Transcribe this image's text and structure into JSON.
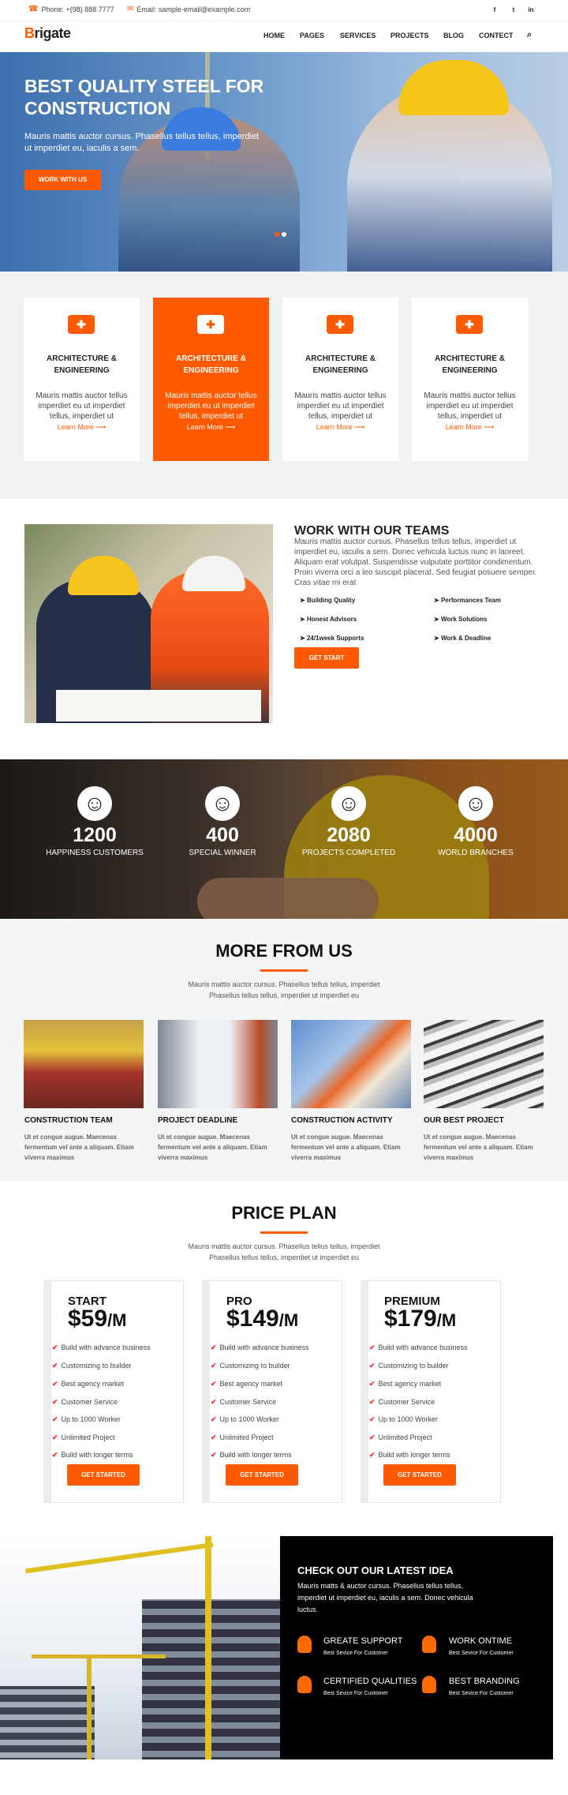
{
  "topbar": {
    "phone": "Phone: +(98) 888 7777",
    "email": "Email: sample-email@example.com",
    "social": [
      "f",
      "t",
      "in"
    ]
  },
  "nav": {
    "logo_b": "B",
    "logo_rest": "rigate",
    "items": [
      "HOME",
      "PAGES",
      "SERVICES",
      "PROJECTS",
      "BLOG",
      "CONTECT"
    ]
  },
  "hero": {
    "title": "BEST QUALITY STEEL FOR CONSTRUCTION",
    "text": "Mauris mattis auctor cursus. Phasellus tellus tellus, imperdiet ut imperdiet eu, iaculis a sem.",
    "button": "WORK WITH US"
  },
  "features": [
    {
      "title": "ARCHITECTURE & ENGINEERING",
      "text": "Mauris mattis auctor tellus imperdiet eu ut imperdiet tellus, imperdiet ut",
      "link": "Learn More"
    },
    {
      "title": "ARCHITECTURE & ENGINEERING",
      "text": "Mauris mattis auctor tellus imperdiet eu ut imperdiet tellus, imperdiet ut",
      "link": "Learn More"
    },
    {
      "title": "ARCHITECTURE & ENGINEERING",
      "text": "Mauris mattis auctor tellus imperdiet eu ut imperdiet tellus, imperdiet ut",
      "link": "Learn More"
    },
    {
      "title": "ARCHITECTURE & ENGINEERING",
      "text": "Mauris mattis auctor tellus imperdiet eu ut imperdiet tellus, imperdiet ut",
      "link": "Learn More"
    }
  ],
  "teams": {
    "title": "WORK WITH OUR TEAMS",
    "text": "Mauris mattis auctor cursus. Phasellus tellus tellus, imperdiet ut imperdiet eu, iaculis a sem. Donec vehicula luctus nunc in laoreet. Aliquam erat volutpat. Suspendisse vulputate porttitor condimentum. Proin viverra orci a leo suscipit placerat. Sed feugiat posuere semper. Cras vitae mi erat",
    "items": [
      "Building Quality",
      "Performances Team",
      "Honest Advisors",
      "Work Solutions",
      "24/1week Supports",
      "Work & Deadline"
    ],
    "button": "GET START"
  },
  "stats": [
    {
      "number": "1200",
      "label": "HAPPINESS CUSTOMERS"
    },
    {
      "number": "400",
      "label": "SPECIAL WINNER"
    },
    {
      "number": "2080",
      "label": "PROJECTS COMPLETED"
    },
    {
      "number": "4000",
      "label": "WORLD BRANCHES"
    }
  ],
  "more": {
    "title": "MORE FROM US",
    "text": "Mauris mattis auctor cursus. Phasellus tellus tellus, imperdiet Phasellus tellus tellus, imperdiet ut imperdiet eu",
    "projects": [
      {
        "title": "CONSTRUCTION TEAM",
        "text": "Ut et congue augue. Maecenas fermentum vel ante a aliquam. Etiam viverra maximus"
      },
      {
        "title": "PROJECT DEADLINE",
        "text": "Ut et congue augue. Maecenas fermentum vel ante a aliquam. Etiam viverra maximus"
      },
      {
        "title": "CONSTRUCTION ACTIVITY",
        "text": "Ut et congue augue. Maecenas fermentum vel ante a aliquam. Etiam viverra maximus"
      },
      {
        "title": "OUR BEST PROJECT",
        "text": "Ut et congue augue. Maecenas fermentum vel ante a aliquam. Etiam viverra maximus"
      }
    ]
  },
  "pricing": {
    "title": "PRICE PLAN",
    "text": "Mauris mattis auctor cursus. Phasellus tellus tellus, imperdiet Phasellus tellus tellus, imperdiet ut imperdiet eu",
    "plans": [
      {
        "name": "START",
        "price": "$59",
        "unit": "/M"
      },
      {
        "name": "PRO",
        "price": "$149",
        "unit": "/M"
      },
      {
        "name": "PREMIUM",
        "price": "$179",
        "unit": "/M"
      }
    ],
    "features": [
      "Build with advance business",
      "Customizing to builder",
      "Best agency market",
      "Customer Service",
      "Up to 1000 Worker",
      "Unlimited Project",
      "Build with longer terms"
    ],
    "button": "GET STARTED"
  },
  "bottom": {
    "title": "CHECK OUT OUR LATEST IDEA",
    "text": "Mauris matts & auctor cursus. Phasellus tellus tellus, imperdiet ut imperdiet eu, iaculis a sem. Donec vehicula luctus.",
    "features": [
      {
        "title": "GREATE SUPPORT",
        "sub": "Best Sevice For Customer"
      },
      {
        "title": "WORK ONTIME",
        "sub": "Best Sevice For Customer"
      },
      {
        "title": "CERTIFIED QUALITIES",
        "sub": "Best Sevice For Customer"
      },
      {
        "title": "BEST BRANDING",
        "sub": "Best Sevice For Customer"
      }
    ]
  },
  "colors": {
    "accent": "#ff5a00",
    "dark": "#111111",
    "light_bg": "#f1f2f4"
  }
}
